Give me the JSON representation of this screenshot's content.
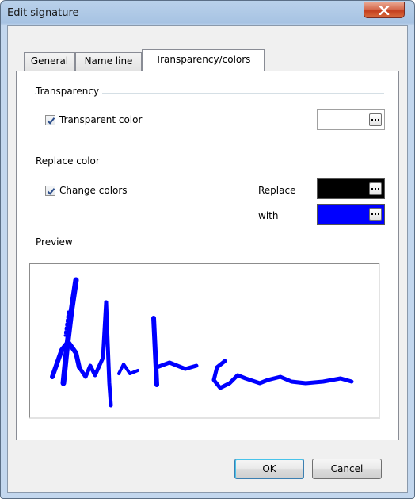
{
  "window": {
    "title": "Edit signature"
  },
  "tabs": [
    {
      "label": "General"
    },
    {
      "label": "Name line"
    },
    {
      "label": "Transparency/colors"
    }
  ],
  "transparency": {
    "group_label": "Transparency",
    "checkbox_label": "Transparent color",
    "checked": true,
    "color": "#ffffff"
  },
  "replace": {
    "group_label": "Replace color",
    "checkbox_label": "Change colors",
    "checked": true,
    "replace_label": "Replace",
    "with_label": "with",
    "replace_color": "#000000",
    "with_color": "#0000ff"
  },
  "preview": {
    "group_label": "Preview",
    "ink_color": "#0000ff"
  },
  "buttons": {
    "ok": "OK",
    "cancel": "Cancel"
  },
  "icons": {
    "close": "close-icon",
    "checkmark": "check-icon",
    "ellipsis": "ellipsis-icon"
  }
}
